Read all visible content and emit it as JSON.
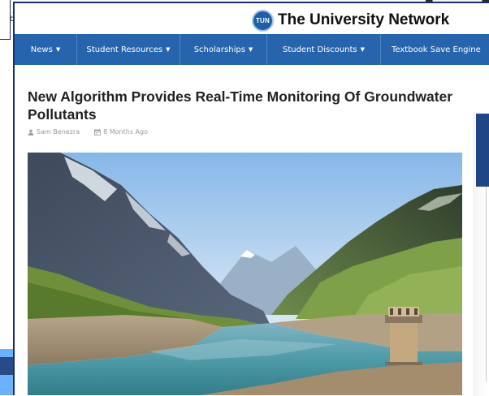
{
  "background": {
    "fragment_text": ",\nb"
  },
  "brand": {
    "logo_text": "TUN",
    "name": "The University Network"
  },
  "nav": {
    "items": [
      {
        "label": "News",
        "caret": "▼"
      },
      {
        "label": "Student Resources",
        "caret": "▼"
      },
      {
        "label": "Scholarships",
        "caret": "▼"
      },
      {
        "label": "Student Discounts",
        "caret": "▼"
      },
      {
        "label": "Textbook Save Engine",
        "caret": ""
      }
    ]
  },
  "article": {
    "title": "New Algorithm Provides Real-Time Monitoring Of Groundwater Pollutants",
    "author": "Sam Benezra",
    "date": "8 Months Ago",
    "hero_icon": "mountain-lake-photo"
  },
  "colors": {
    "nav_bg": "#2665ad",
    "brand_logo": "#1f5fa8",
    "frame_border": "#1a2e6e"
  }
}
